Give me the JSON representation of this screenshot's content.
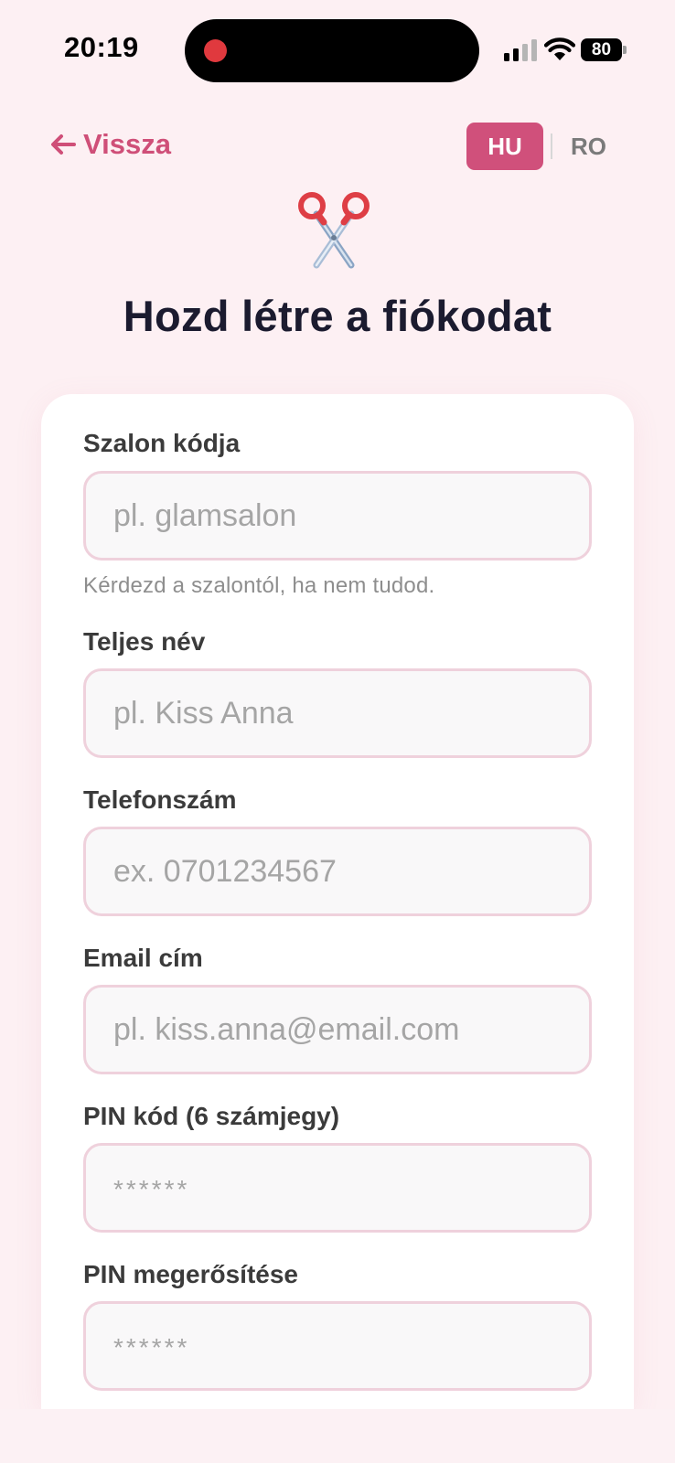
{
  "status_bar": {
    "time": "20:19",
    "battery": "80",
    "icons": [
      "signal-icon",
      "wifi-icon",
      "battery-icon"
    ]
  },
  "nav": {
    "back_label": "Vissza",
    "back_icon": "arrow-left-icon",
    "languages": [
      "HU",
      "RO"
    ],
    "active_language": "HU"
  },
  "header": {
    "icon": "scissors-icon",
    "title": "Hozd létre a fiókodat"
  },
  "form": {
    "salon_code": {
      "label": "Szalon kódja",
      "placeholder": "pl. glamsalon",
      "hint": "Kérdezd a szalontól, ha nem tudod."
    },
    "full_name": {
      "label": "Teljes név",
      "placeholder": "pl. Kiss Anna"
    },
    "phone": {
      "label": "Telefonszám",
      "placeholder": "ex. 0701234567"
    },
    "email": {
      "label": "Email cím",
      "placeholder": "pl. kiss.anna@email.com"
    },
    "pin": {
      "label": "PIN kód (6 számjegy)",
      "placeholder": "******"
    },
    "pin_confirm": {
      "label": "PIN megerősítése",
      "placeholder": "******"
    }
  },
  "colors": {
    "accent": "#d0507b",
    "background": "#fdf0f3",
    "input_border": "#efd1dc",
    "title": "#1b1b2f"
  }
}
